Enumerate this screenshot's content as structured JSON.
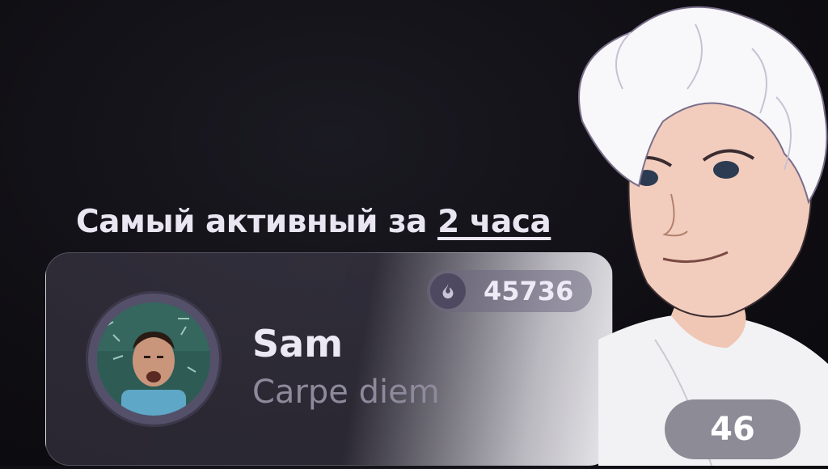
{
  "header": {
    "title_prefix": "Самый активный за ",
    "title_highlight": "2 часа"
  },
  "user_card": {
    "points": "45736",
    "points_icon": "flame-icon",
    "name": "Sam",
    "status": "Carpe diem"
  },
  "counter": {
    "value": "46"
  },
  "colors": {
    "background": "#0f0e13",
    "text_primary": "#ece8f4",
    "text_secondary": "#8e8a9c",
    "badge": "#6e6880"
  }
}
